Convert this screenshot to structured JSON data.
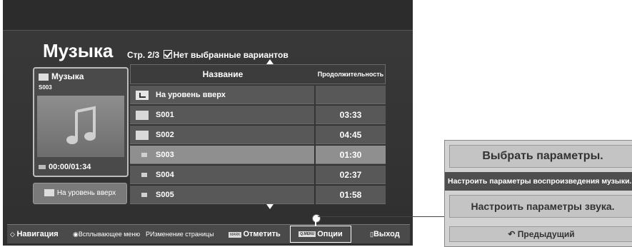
{
  "screen": {
    "title": "Музыка",
    "page_info": "Стр. 2/3",
    "selection_info": "Нет выбранные вариантов"
  },
  "left_panel": {
    "folder_label": "Музыка",
    "track": "S003",
    "time": "00:00/01:34",
    "up_button": "На уровень вверх"
  },
  "table": {
    "headers": {
      "name": "Название",
      "duration": "Продолжительность"
    },
    "rows": [
      {
        "icon": "up-folder-icon",
        "name": "На уровень вверх",
        "duration": ""
      },
      {
        "icon": "folder-icon",
        "name": "S001",
        "duration": "03:33"
      },
      {
        "icon": "folder-icon",
        "name": "S002",
        "duration": "04:45"
      },
      {
        "icon": "music-file-icon",
        "name": "S003",
        "duration": "01:30",
        "selected": true
      },
      {
        "icon": "music-file-icon",
        "name": "S004",
        "duration": "02:37"
      },
      {
        "icon": "music-file-icon",
        "name": "S005",
        "duration": "01:58"
      }
    ]
  },
  "bottom_bar": {
    "navigation": "Навигация",
    "popup_menu": "Всплывающее меню",
    "page_change_key": "P",
    "page_change": "Изменение страницы",
    "mark_key": "MARK",
    "mark": "Отметить",
    "options_key": "Q.MENU",
    "options": "Опции",
    "exit": "Выход"
  },
  "popup": {
    "title": "Выбрать параметры.",
    "items": [
      "Настроить параметры воспроизведения музыки.",
      "Настроить параметры звука."
    ],
    "previous": "Предыдущий"
  }
}
